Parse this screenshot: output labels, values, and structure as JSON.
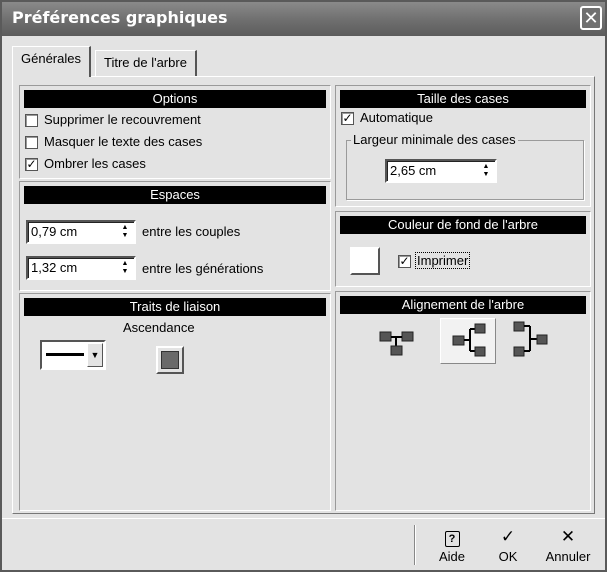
{
  "window": {
    "title": "Préférences graphiques"
  },
  "tabs": [
    {
      "label": "Générales",
      "active": true
    },
    {
      "label": "Titre de l'arbre",
      "active": false
    }
  ],
  "options": {
    "header": "Options",
    "items": [
      {
        "label": "Supprimer le recouvrement",
        "checked": false
      },
      {
        "label": "Masquer le texte des cases",
        "checked": false
      },
      {
        "label": "Ombrer les cases",
        "checked": true
      }
    ]
  },
  "espaces": {
    "header": "Espaces",
    "couples_value": "0,79 cm",
    "couples_label": "entre les couples",
    "generations_value": "1,32 cm",
    "generations_label": "entre les générations"
  },
  "traits": {
    "header": "Traits de liaison",
    "ascendance_label": "Ascendance",
    "swatch_color": "#6a6a6a"
  },
  "taille": {
    "header": "Taille des cases",
    "auto_label": "Automatique",
    "auto_checked": true,
    "min_width_legend": "Largeur minimale des cases",
    "min_width_value": "2,65 cm"
  },
  "couleur": {
    "header": "Couleur de fond de l'arbre",
    "print_label": "Imprimer",
    "print_checked": true,
    "bg_color": "#ffffff"
  },
  "alignement": {
    "header": "Alignement de l'arbre",
    "options": [
      "align-top-icon",
      "align-center-icon",
      "align-right-icon"
    ],
    "selected_index": 1
  },
  "footer": {
    "help": "Aide",
    "ok": "OK",
    "cancel": "Annuler"
  }
}
